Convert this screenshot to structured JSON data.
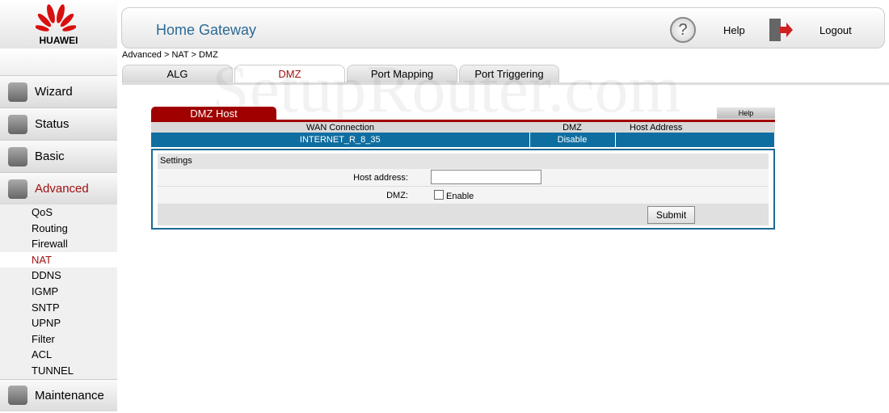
{
  "brand": {
    "logo_text": "HUAWEI",
    "watermark": "SetupRouter.com"
  },
  "header": {
    "title": "Home Gateway",
    "help_label": "Help",
    "logout_label": "Logout"
  },
  "breadcrumb": "Advanced > NAT > DMZ",
  "sidebar": {
    "main": [
      {
        "label": "Wizard",
        "icon": "wizard-icon"
      },
      {
        "label": "Status",
        "icon": "gear-icon"
      },
      {
        "label": "Basic",
        "icon": "basic-icon"
      },
      {
        "label": "Advanced",
        "icon": "advanced-icon"
      },
      {
        "label": "Maintenance",
        "icon": "maintenance-icon"
      }
    ],
    "sub": [
      "QoS",
      "Routing",
      "Firewall",
      "NAT",
      "DDNS",
      "IGMP",
      "SNTP",
      "UPNP",
      "Filter",
      "ACL",
      "TUNNEL"
    ],
    "selected_sub": "NAT"
  },
  "tabs": [
    {
      "label": "ALG"
    },
    {
      "label": "DMZ",
      "selected": true
    },
    {
      "label": "Port Mapping"
    },
    {
      "label": "Port Triggering"
    }
  ],
  "panel": {
    "title": "DMZ Host",
    "help": "Help",
    "columns": [
      "WAN Connection",
      "DMZ",
      "Host Address"
    ],
    "rows": [
      [
        "INTERNET_R_8_35",
        "Disable",
        ""
      ]
    ],
    "settings_label": "Settings",
    "host_label": "Host address:",
    "host_value": "",
    "dmz_label": "DMZ:",
    "enable_label": "Enable",
    "enable_checked": false,
    "submit": "Submit"
  },
  "colors": {
    "accent_red": "#a00000",
    "row_blue": "#0f6ea0",
    "title_blue": "#2c6a95"
  }
}
